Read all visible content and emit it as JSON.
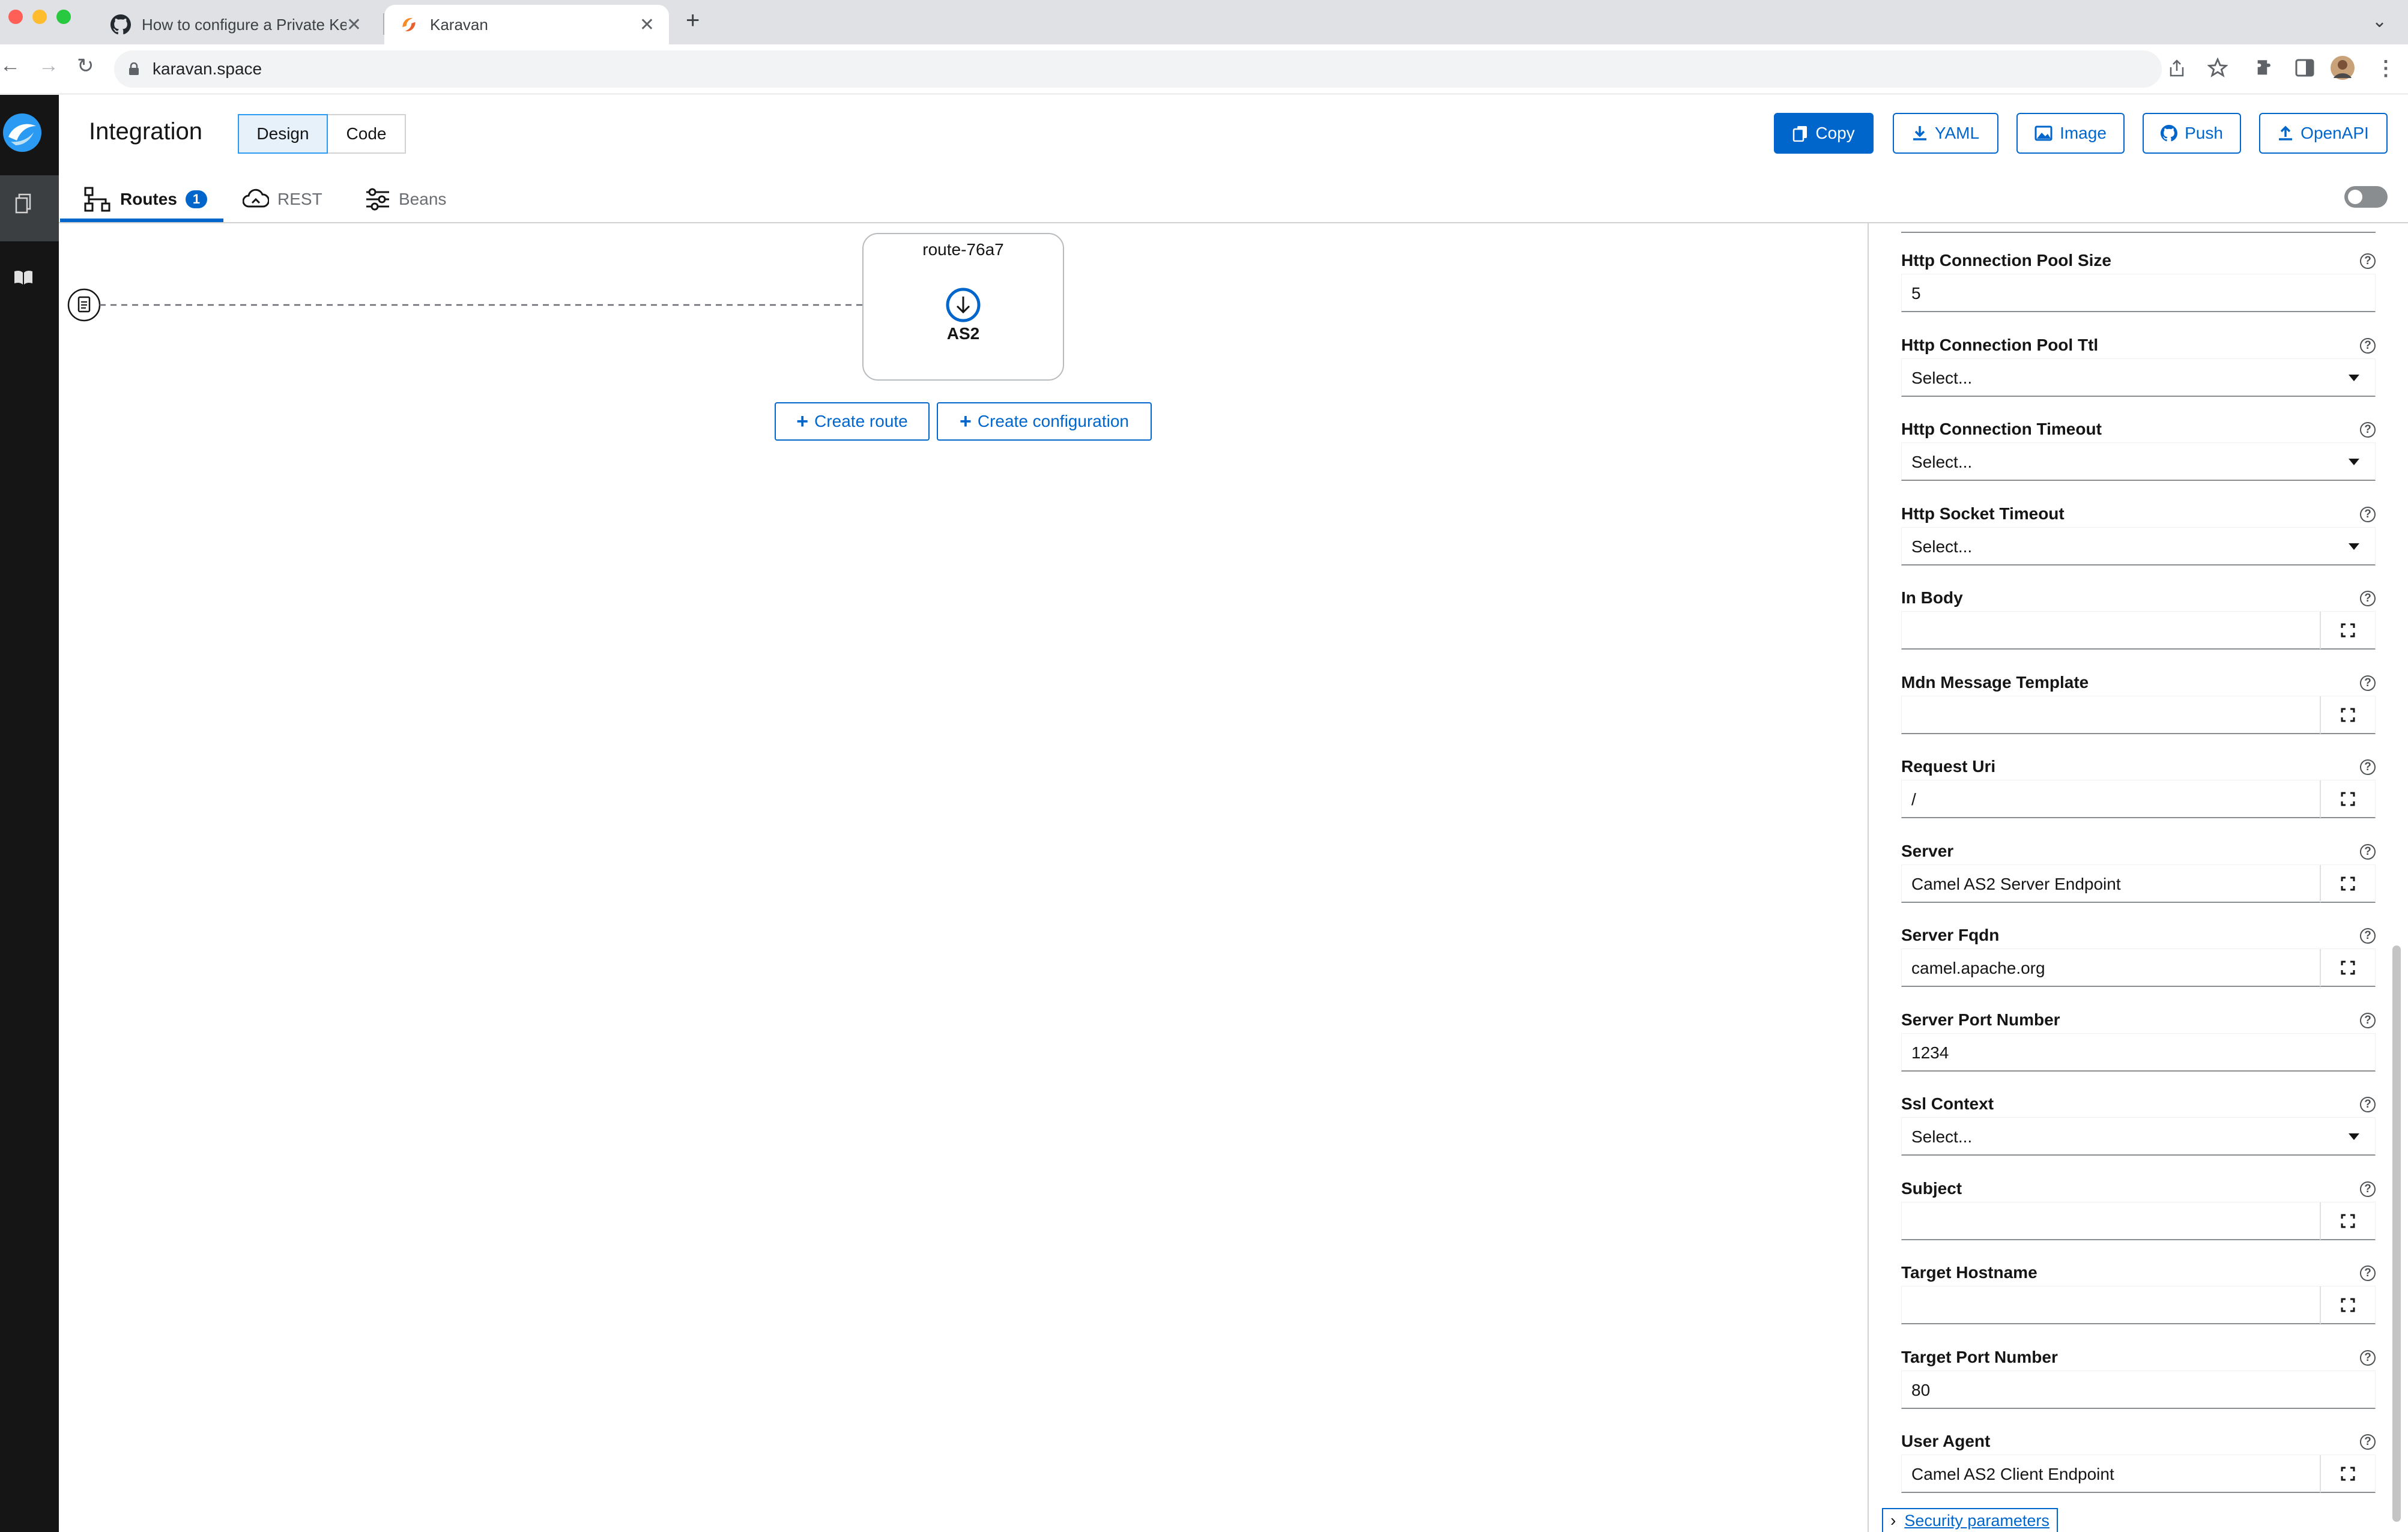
{
  "browser": {
    "tabs": [
      {
        "title": "How to configure a Private Key",
        "icon": "github-icon"
      },
      {
        "title": "Karavan",
        "icon": "karavan-icon"
      }
    ],
    "new_tab": "+",
    "url": "karavan.space"
  },
  "app": {
    "title": "Integration",
    "mode_buttons": [
      {
        "label": "Design",
        "active": true
      },
      {
        "label": "Code",
        "active": false
      }
    ],
    "header_buttons": [
      {
        "label": "Copy",
        "icon": "copy-icon",
        "style": "primary"
      },
      {
        "label": "YAML",
        "icon": "download-icon",
        "style": "secondary"
      },
      {
        "label": "Image",
        "icon": "image-icon",
        "style": "secondary"
      },
      {
        "label": "Push",
        "icon": "github-icon",
        "style": "secondary"
      },
      {
        "label": "OpenAPI",
        "icon": "upload-icon",
        "style": "secondary"
      }
    ],
    "tabs": [
      {
        "label": "Routes",
        "badge": "1",
        "active": true
      },
      {
        "label": "REST"
      },
      {
        "label": "Beans"
      }
    ]
  },
  "canvas": {
    "route_name": "route-76a7",
    "step_label": "AS2",
    "create_route": "Create route",
    "create_configuration": "Create configuration"
  },
  "properties": [
    {
      "label": "Http Connection Pool Size",
      "type": "text",
      "value": "5"
    },
    {
      "label": "Http Connection Pool Ttl",
      "type": "select",
      "value": "Select..."
    },
    {
      "label": "Http Connection Timeout",
      "type": "select",
      "value": "Select..."
    },
    {
      "label": "Http Socket Timeout",
      "type": "select",
      "value": "Select..."
    },
    {
      "label": "In Body",
      "type": "expand",
      "value": ""
    },
    {
      "label": "Mdn Message Template",
      "type": "expand",
      "value": ""
    },
    {
      "label": "Request Uri",
      "type": "expand",
      "value": "/"
    },
    {
      "label": "Server",
      "type": "expand",
      "value": "Camel AS2 Server Endpoint"
    },
    {
      "label": "Server Fqdn",
      "type": "expand",
      "value": "camel.apache.org"
    },
    {
      "label": "Server Port Number",
      "type": "text",
      "value": "1234"
    },
    {
      "label": "Ssl Context",
      "type": "select",
      "value": "Select..."
    },
    {
      "label": "Subject",
      "type": "expand",
      "value": ""
    },
    {
      "label": "Target Hostname",
      "type": "expand",
      "value": ""
    },
    {
      "label": "Target Port Number",
      "type": "text",
      "value": "80"
    },
    {
      "label": "User Agent",
      "type": "expand",
      "value": "Camel AS2 Client Endpoint"
    }
  ],
  "help_glyph": "?",
  "security_parameters": "Security parameters",
  "colors": {
    "accent": "#0066cc",
    "sidebar": "#151515"
  }
}
